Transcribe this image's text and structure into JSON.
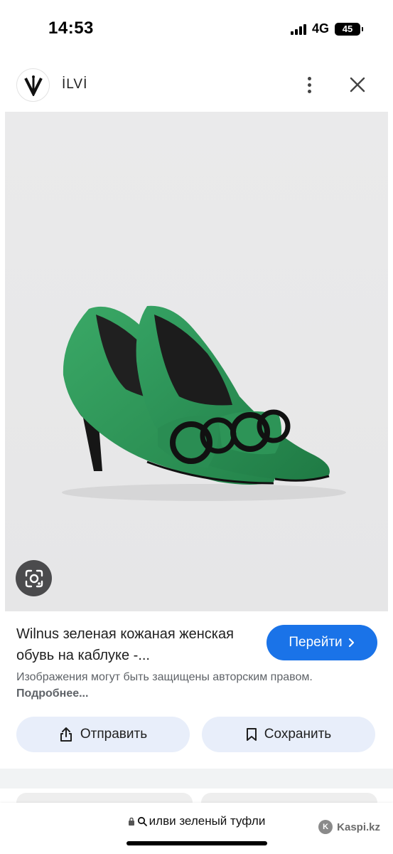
{
  "status_bar": {
    "time": "14:53",
    "network": "4G",
    "battery": "45"
  },
  "header": {
    "site_name": "İLVİ",
    "logo_icon": "ilvi-logo-icon",
    "more_icon": "more-vert-icon",
    "close_icon": "close-icon"
  },
  "image": {
    "subject": "green-pumps-with-black-buckle",
    "lens_icon": "google-lens-icon"
  },
  "result": {
    "title": "Wilnus зеленая кожаная женская обувь на каблуке -...",
    "visit_label": "Перейти",
    "copyright_text": "Изображения могут быть защищены авторским правом.",
    "more_link": "Подробнее..."
  },
  "actions": {
    "share_label": "Отправить",
    "save_label": "Сохранить"
  },
  "browser": {
    "url_text": "илви зеленый туфли",
    "badge_text": "Kaspi.kz"
  },
  "colors": {
    "accent": "#1a73e8",
    "action_bg": "#e8eefa",
    "image_bg": "#e9e9ea",
    "shoe_green": "#2e9a5a"
  }
}
